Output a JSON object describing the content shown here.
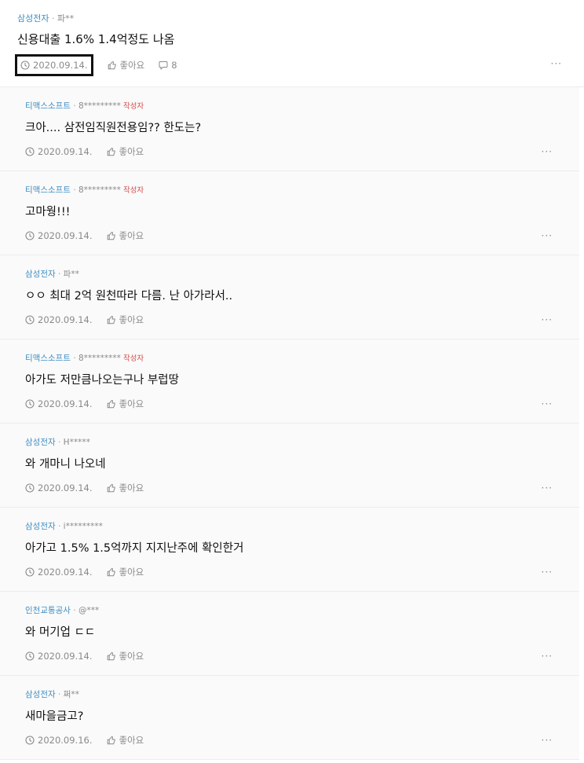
{
  "post": {
    "company": "삼성전자",
    "separator": "·",
    "user": "파**",
    "text": "신용대출 1.6% 1.4억정도 나옴",
    "date": "2020.09.14.",
    "like_label": "좋아요",
    "comment_count": "8",
    "more": "···"
  },
  "replies": [
    {
      "company": "티맥스소프트",
      "user": "8*********",
      "badge": "작성자",
      "text": "크아.... 삼전임직원전용임?? 한도는?",
      "date": "2020.09.14.",
      "like_label": "좋아요",
      "more": "···"
    },
    {
      "company": "티맥스소프트",
      "user": "8*********",
      "badge": "작성자",
      "text": "고마웡!!!",
      "date": "2020.09.14.",
      "like_label": "좋아요",
      "more": "···"
    },
    {
      "company": "삼성전자",
      "user": "파**",
      "badge": "",
      "text": "ㅇㅇ 최대 2억 원천따라 다름. 난 아가라서..",
      "date": "2020.09.14.",
      "like_label": "좋아요",
      "more": "···"
    },
    {
      "company": "티맥스소프트",
      "user": "8*********",
      "badge": "작성자",
      "text": "아가도 저만큼나오는구나 부럽땅",
      "date": "2020.09.14.",
      "like_label": "좋아요",
      "more": "···"
    },
    {
      "company": "삼성전자",
      "user": "H*****",
      "badge": "",
      "text": "와 개마니 나오네",
      "date": "2020.09.14.",
      "like_label": "좋아요",
      "more": "···"
    },
    {
      "company": "삼성전자",
      "user": "i*********",
      "badge": "",
      "text": "아가고 1.5% 1.5억까지 지지난주에 확인한거",
      "date": "2020.09.14.",
      "like_label": "좋아요",
      "more": "···"
    },
    {
      "company": "인천교통공사",
      "user": "@***",
      "badge": "",
      "text": "와 머기업 ㄷㄷ",
      "date": "2020.09.14.",
      "like_label": "좋아요",
      "more": "···"
    },
    {
      "company": "삼성전자",
      "user": "쩌**",
      "badge": "",
      "text": "새마을금고?",
      "date": "2020.09.16.",
      "like_label": "좋아요",
      "more": "···"
    }
  ],
  "colors": {
    "company": "#3f8ec2",
    "badge": "#d04a4a",
    "meta": "#8a8a8a",
    "reply_bg": "#fafafa"
  },
  "icons": {
    "date": "clock-icon",
    "like": "thumbs-up-icon",
    "comment": "comment-icon"
  }
}
